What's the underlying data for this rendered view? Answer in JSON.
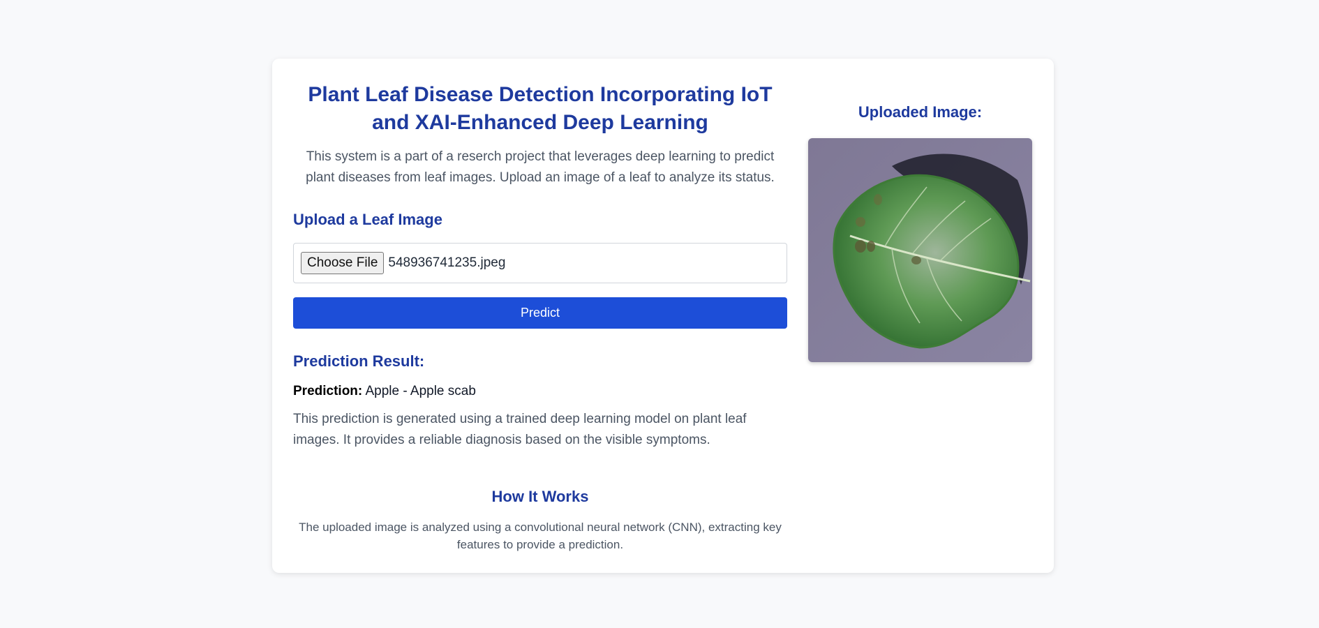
{
  "header": {
    "title": "Plant Leaf Disease Detection Incorporating IoT and XAI-Enhanced Deep Learning",
    "intro": "This system is a part of a reserch project that leverages deep learning to predict plant diseases from leaf images. Upload an image of a leaf to analyze its status."
  },
  "upload": {
    "heading": "Upload a Leaf Image",
    "choose_label": "Choose File",
    "file_name": "548936741235.jpeg",
    "predict_label": "Predict"
  },
  "result": {
    "heading": "Prediction Result:",
    "prediction_label": "Prediction:",
    "prediction_value": "Apple - Apple scab",
    "explanation": "This prediction is generated using a trained deep learning model on plant leaf images. It provides a reliable diagnosis based on the visible symptoms."
  },
  "how": {
    "heading": "How It Works",
    "text": "The uploaded image is analyzed using a convolutional neural network (CNN), extracting key features to provide a prediction."
  },
  "preview": {
    "heading": "Uploaded Image:"
  },
  "colors": {
    "accent": "#1e3a9e",
    "button": "#1d4ed8",
    "background": "#f8f9fb"
  }
}
